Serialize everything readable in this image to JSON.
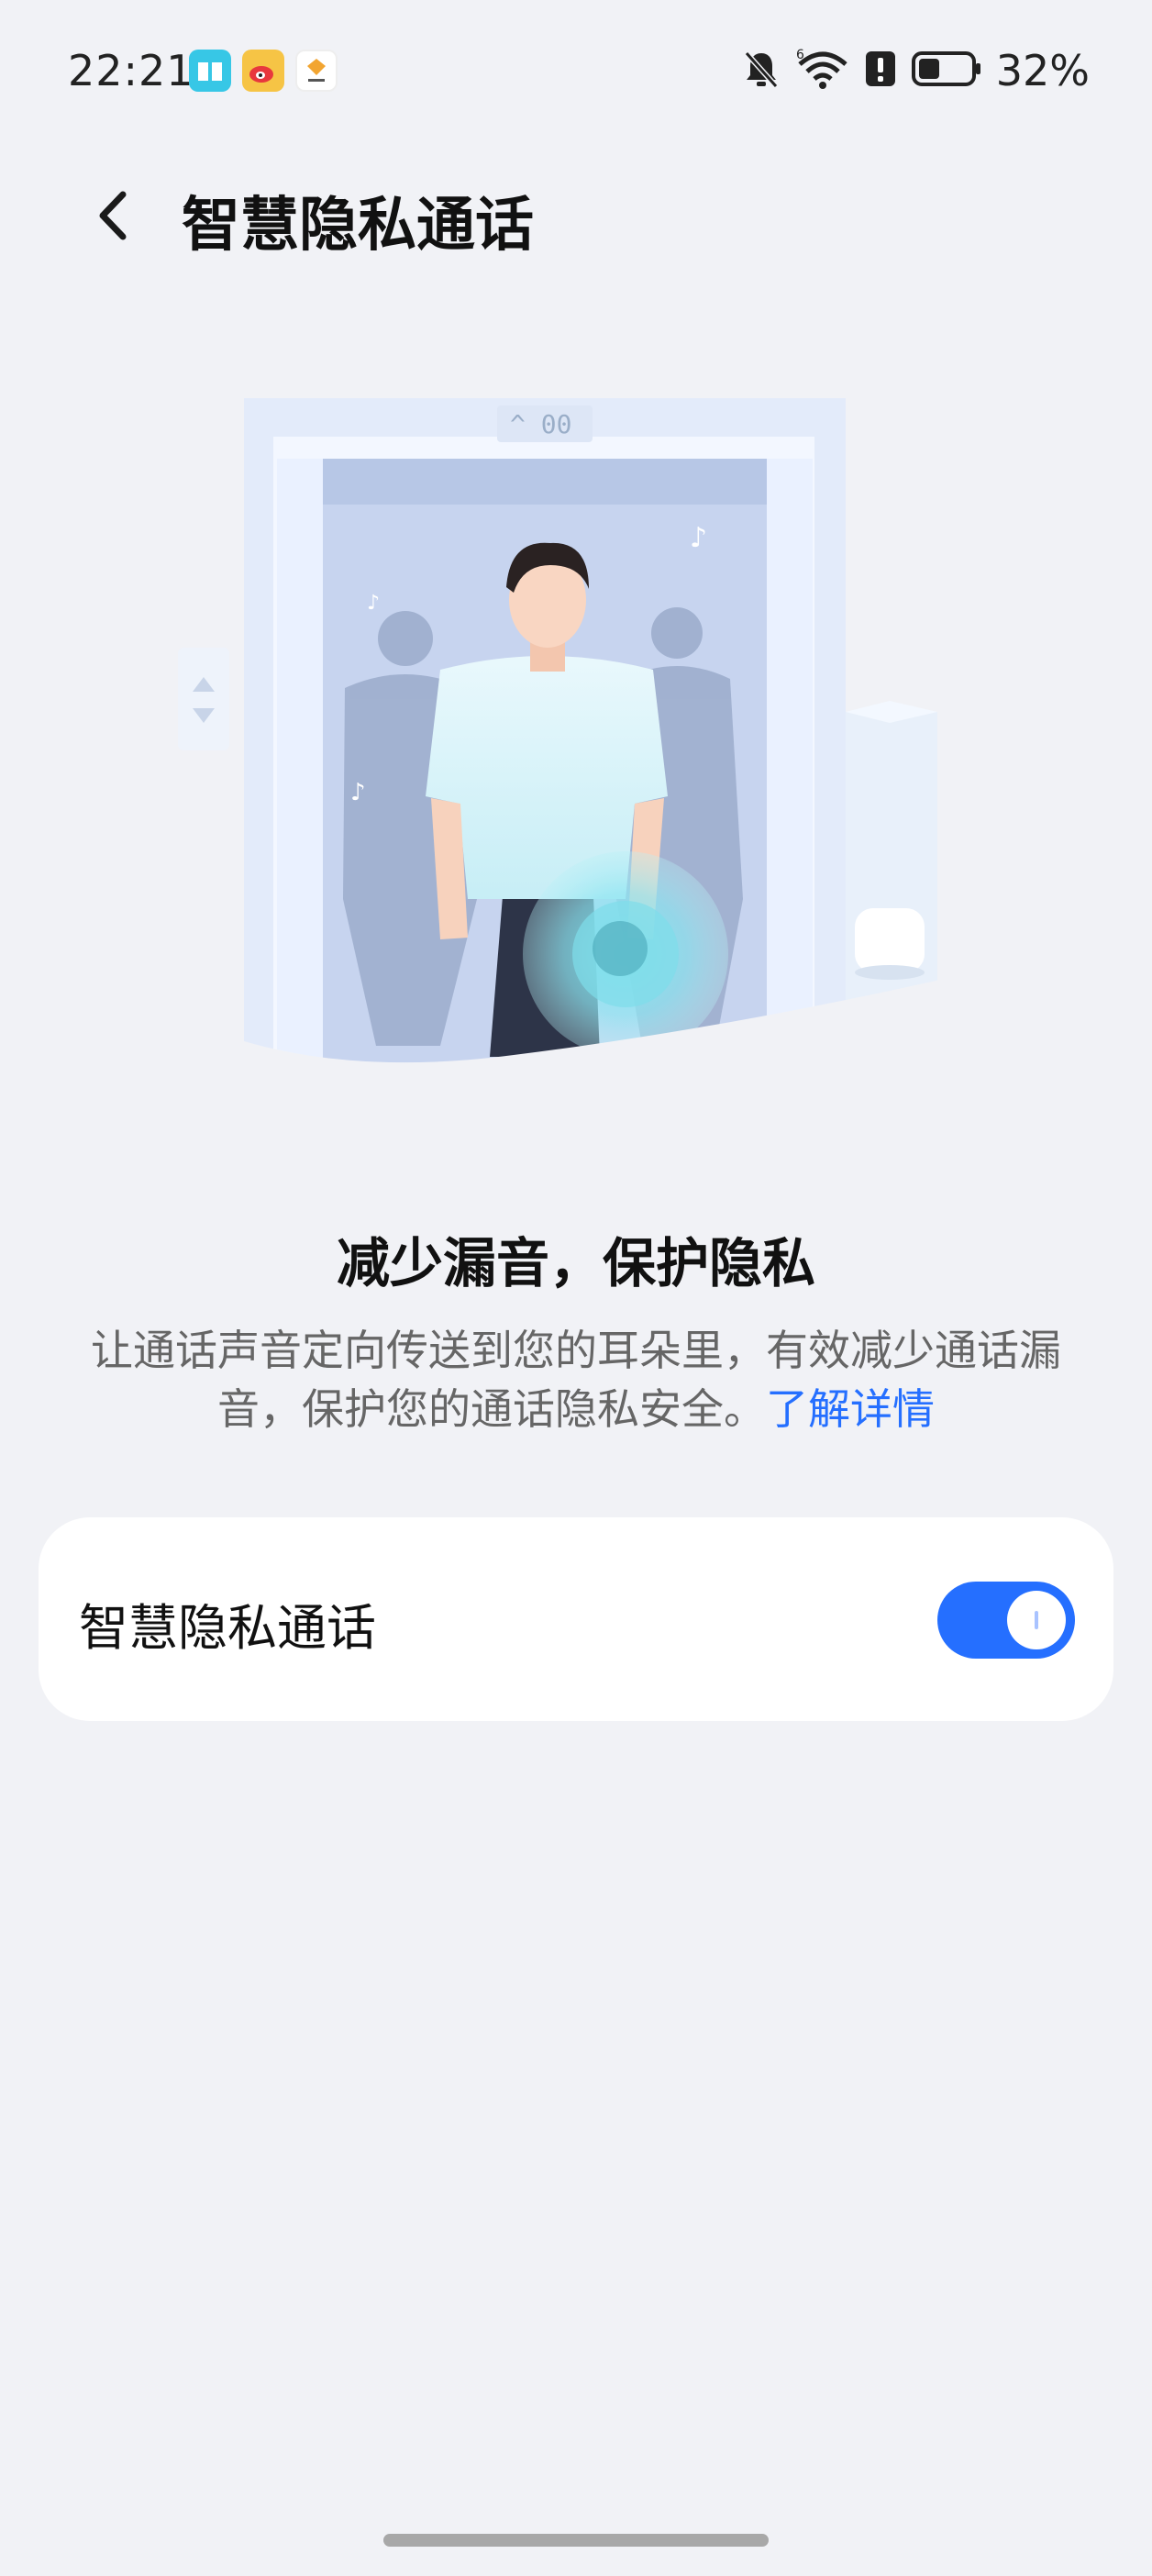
{
  "status_bar": {
    "time": "22:21",
    "app_icons": [
      "reader-app-icon",
      "weibo-app-icon",
      "honor-app-icon"
    ],
    "right_icons": [
      "mute-bell-icon",
      "wifi-6-icon",
      "alert-icon",
      "battery-icon"
    ],
    "battery_text": "32%"
  },
  "header": {
    "title": "智慧隐私通话",
    "back_icon": "chevron-left-icon"
  },
  "content": {
    "headline": "减少漏音，保护隐私",
    "description": "让通话声音定向传送到您的耳朵里，有效减少通话漏音，保护您的通话隐私安全。",
    "learn_more": "了解详情"
  },
  "setting": {
    "label": "智慧隐私通话",
    "enabled": true
  },
  "colors": {
    "accent": "#256fff",
    "background": "#f1f2f6",
    "card": "#ffffff"
  }
}
